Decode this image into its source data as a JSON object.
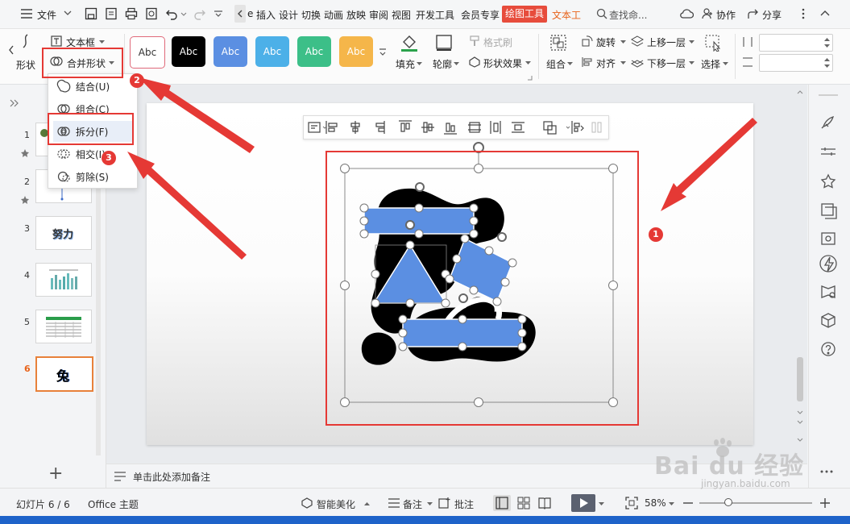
{
  "menubar": {
    "menu_label": "文件",
    "tabs": [
      "插入",
      "设计",
      "切换",
      "动画",
      "放映",
      "审阅",
      "视图",
      "开发工具",
      "会员专享"
    ],
    "active_tab": "绘图工具",
    "extra_tab": "文本工",
    "search_placeholder": "查找命...",
    "collab": "协作",
    "share": "分享"
  },
  "ribbon": {
    "textbox": "文本框",
    "shape_partial": "形状",
    "merge_shapes": "合并形状",
    "style_samples": [
      "Abc",
      "Abc",
      "Abc",
      "Abc",
      "Abc",
      "Abc"
    ],
    "fill": "填充",
    "outline": "轮廓",
    "format_painter": "格式刷",
    "shape_effects": "形状效果",
    "group": "组合",
    "rotate": "旋转",
    "align": "对齐",
    "bring_forward": "上移一层",
    "send_backward": "下移一层",
    "select": "选择"
  },
  "dropdown": {
    "items": [
      "结合(U)",
      "组合(C)",
      "拆分(F)",
      "相交(I)",
      "剪除(S)"
    ]
  },
  "slides": {
    "numbers": [
      "1",
      "2",
      "3",
      "4",
      "5",
      "6"
    ],
    "thumb3_text": "努力",
    "thumb6_text": "兔",
    "add_symbol": "+"
  },
  "notes": {
    "placeholder": "单击此处添加备注"
  },
  "statusbar": {
    "slide_counter": "幻灯片 6 / 6",
    "theme": "Office 主题",
    "beautify": "智能美化",
    "notes": "备注",
    "comments": "批注",
    "zoom": "58%"
  },
  "annotations": {
    "badges": [
      "1",
      "2",
      "3"
    ]
  },
  "watermark": {
    "logo": "Bai du 经验",
    "url": "jingyan.baidu.com"
  },
  "colors": {
    "accent_red": "#e53935",
    "shape_blue": "#5b8fe2",
    "tab_red": "#e74c3c",
    "status_blue": "#1e63c9"
  }
}
